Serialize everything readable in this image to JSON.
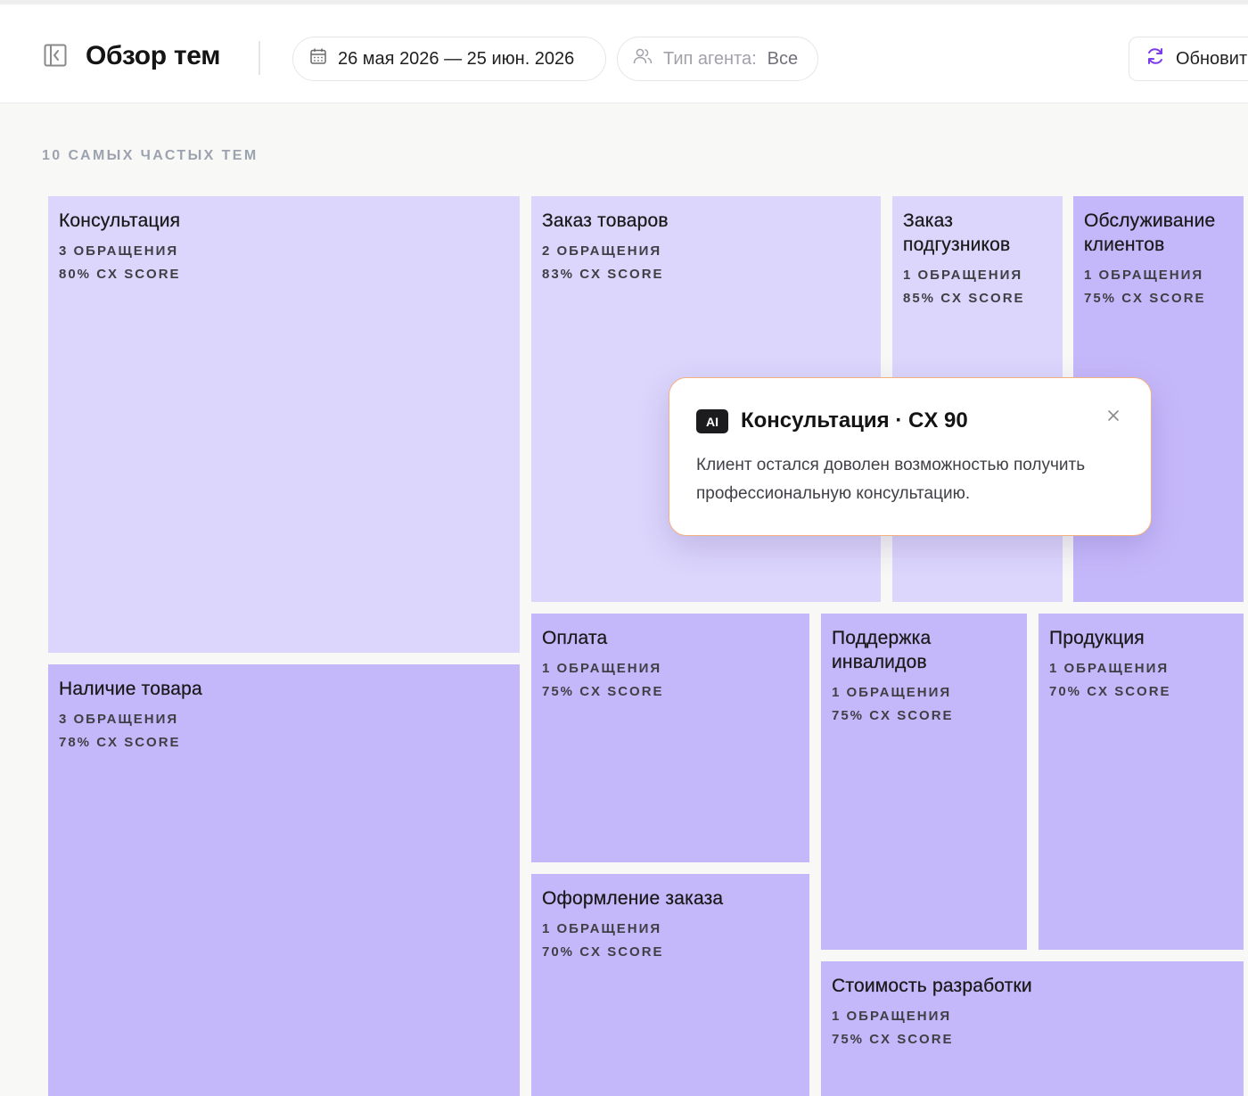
{
  "header": {
    "title": "Обзор тем",
    "date_range": "26 мая 2026 — 25 июн. 2026",
    "agent_filter_label": "Тип агента:",
    "agent_filter_value": "Все",
    "refresh_label": "Обновит"
  },
  "section": {
    "title": "10 САМЫХ ЧАСТЫХ ТЕМ"
  },
  "topics": [
    {
      "name": "Консультация",
      "count": "3 ОБРАЩЕНИЯ",
      "score": "80% CX SCORE"
    },
    {
      "name": "Заказ товаров",
      "count": "2 ОБРАЩЕНИЯ",
      "score": "83% CX SCORE"
    },
    {
      "name": "Заказ подгузников",
      "count": "1 ОБРАЩЕНИЯ",
      "score": "85% CX SCORE"
    },
    {
      "name": "Обслуживание клиентов",
      "count": "1 ОБРАЩЕНИЯ",
      "score": "75% CX SCORE"
    },
    {
      "name": "Наличие товара",
      "count": "3 ОБРАЩЕНИЯ",
      "score": "78% CX SCORE"
    },
    {
      "name": "Оплата",
      "count": "1 ОБРАЩЕНИЯ",
      "score": "75% CX SCORE"
    },
    {
      "name": "Поддержка инвалидов",
      "count": "1 ОБРАЩЕНИЯ",
      "score": "75% CX SCORE"
    },
    {
      "name": "Продукция",
      "count": "1 ОБРАЩЕНИЯ",
      "score": "70% CX SCORE"
    },
    {
      "name": "Оформление заказа",
      "count": "1 ОБРАЩЕНИЯ",
      "score": "70% CX SCORE"
    },
    {
      "name": "Стоимость разработки",
      "count": "1 ОБРАЩЕНИЯ",
      "score": "75% CX SCORE"
    }
  ],
  "tooltip": {
    "badge": "AI",
    "title": "Консультация · CX 90",
    "body": "Клиент остался доволен возможностью получить профессиональную консультацию."
  },
  "colors": {
    "tile_light": "#dcd6fc",
    "tile_mid": "#c5b8fa",
    "refresh_icon": "#7c3aed",
    "tooltip_border": "#f5b080"
  }
}
